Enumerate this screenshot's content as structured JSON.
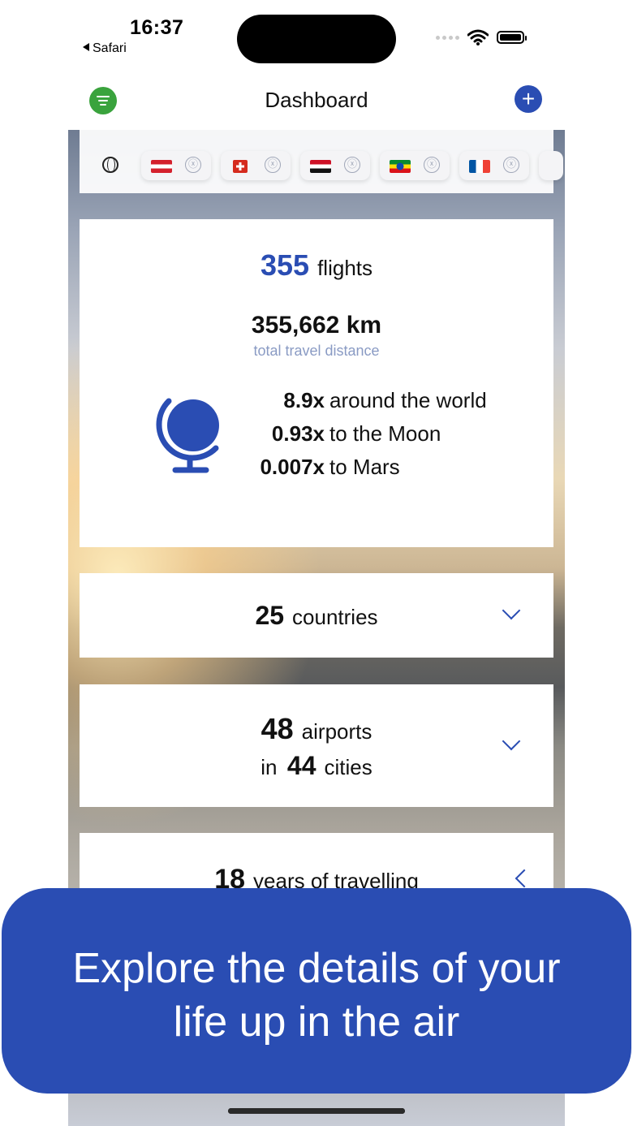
{
  "status_bar": {
    "time": "16:37",
    "back_label": "Safari"
  },
  "nav": {
    "title": "Dashboard",
    "left_icon": "filter-icon",
    "right_icon": "plus-icon"
  },
  "filters": {
    "globe_icon": "globe-icon",
    "chips": [
      {
        "country": "Austria",
        "remove": "ⓧ"
      },
      {
        "country": "Switzerland",
        "remove": "ⓧ"
      },
      {
        "country": "Egypt",
        "remove": "ⓧ"
      },
      {
        "country": "Ethiopia",
        "remove": "ⓧ"
      },
      {
        "country": "France",
        "remove": "ⓧ"
      }
    ]
  },
  "stats": {
    "flights_count": "355",
    "flights_label": "flights",
    "distance": "355,662 km",
    "distance_label": "total travel distance",
    "comparisons": [
      {
        "value": "8.9x",
        "label": "around the world"
      },
      {
        "value": "0.93x",
        "label": "to the Moon"
      },
      {
        "value": "0.007x",
        "label": "to Mars"
      }
    ]
  },
  "countries": {
    "count": "25",
    "label": "countries"
  },
  "airports": {
    "count": "48",
    "label": "airports",
    "in_label": "in",
    "cities_count": "44",
    "cities_label": "cities"
  },
  "years": {
    "count": "18",
    "label": "years of travelling"
  },
  "caption": {
    "line1": "Explore the details of your",
    "line2": "life up in the air"
  },
  "colors": {
    "accent": "#2a4db3",
    "green": "#3aa33d",
    "caption_bg": "#2a4db3"
  }
}
